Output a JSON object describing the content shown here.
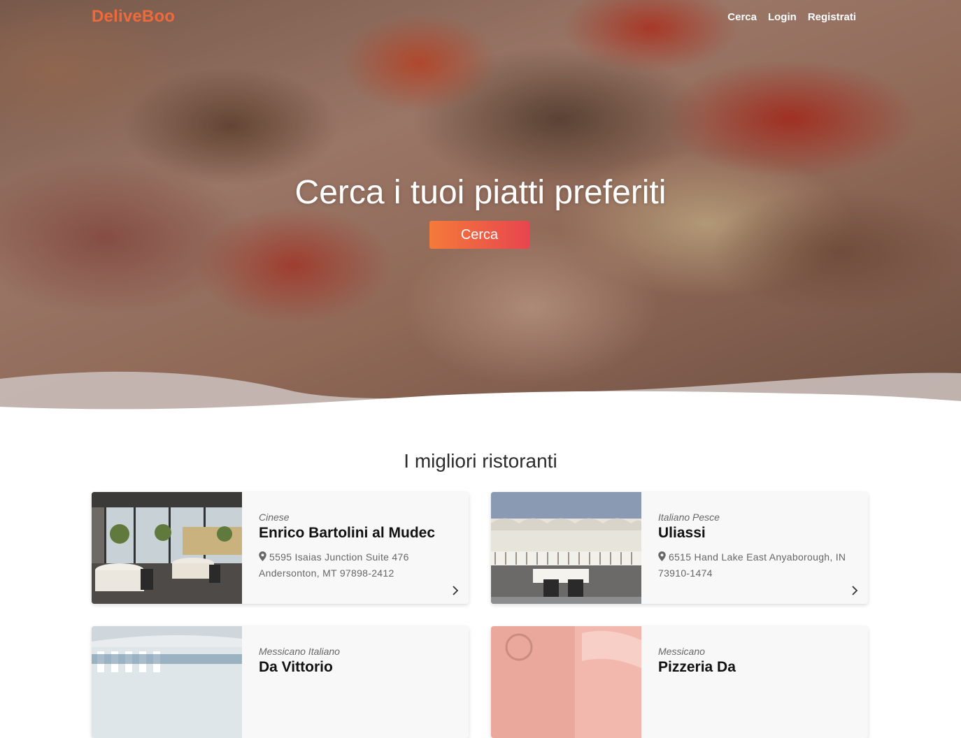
{
  "brand": {
    "name": "DeliveBoo",
    "color": "#ef6a3a"
  },
  "nav": {
    "links": [
      "Cerca",
      "Login",
      "Registrati"
    ]
  },
  "hero": {
    "title": "Cerca i tuoi piatti preferiti",
    "button_label": "Cerca",
    "button_gradient": [
      "#f47a3a",
      "#e8454e"
    ]
  },
  "section": {
    "title": "I migliori ristoranti"
  },
  "restaurants": [
    {
      "category": "Cinese",
      "name": "Enrico Bartolini al Mudec",
      "address": "5595 Isaias Junction Suite 476 Andersonton, MT 97898-2412",
      "icon": "map-pin-icon"
    },
    {
      "category": "Italiano Pesce",
      "name": "Uliassi",
      "address": "6515 Hand Lake East Anyaborough, IN 73910-1474",
      "icon": "map-pin-icon"
    },
    {
      "category": "Messicano Italiano",
      "name": "Da Vittorio",
      "address": "",
      "icon": "map-pin-icon"
    },
    {
      "category": "Messicano",
      "name": "Pizzeria Da",
      "address": "",
      "icon": "map-pin-icon"
    }
  ]
}
